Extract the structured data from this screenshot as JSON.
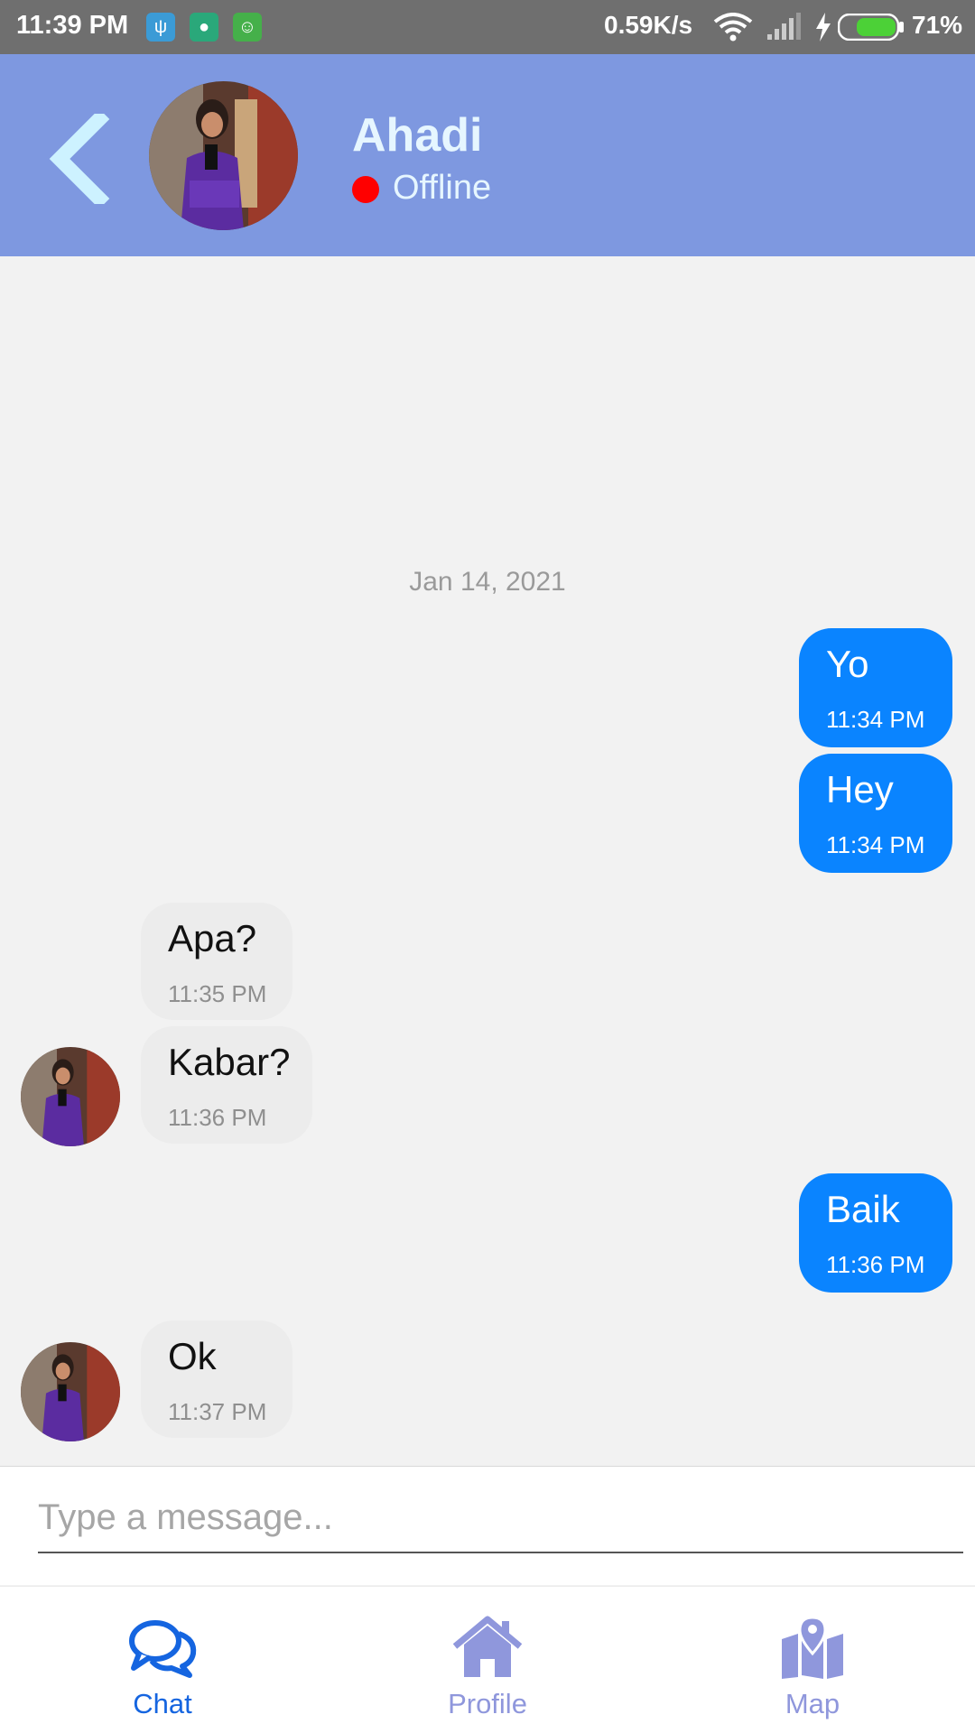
{
  "status_bar": {
    "time": "11:39 PM",
    "network_speed": "0.59K/s",
    "battery_percent": "71%",
    "battery_level": 0.71,
    "app_icons": [
      "usb-icon",
      "shield-icon",
      "android-icon"
    ]
  },
  "header": {
    "contact_name": "Ahadi",
    "status": "Offline",
    "status_color": "#ff0000",
    "background": "#7e98e0"
  },
  "conversation": {
    "date": "Jan 14, 2021",
    "messages": [
      {
        "direction": "sent",
        "text": "Yo",
        "time": "11:34 PM"
      },
      {
        "direction": "sent",
        "text": "Hey",
        "time": "11:34 PM"
      },
      {
        "direction": "received",
        "text": "Apa?",
        "time": "11:35 PM"
      },
      {
        "direction": "received",
        "text": "Kabar?",
        "time": "11:36 PM"
      },
      {
        "direction": "sent",
        "text": "Baik",
        "time": "11:36 PM"
      },
      {
        "direction": "received",
        "text": "Ok",
        "time": "11:37 PM"
      }
    ]
  },
  "composer": {
    "placeholder": "Type a message..."
  },
  "bottom_nav": {
    "items": [
      {
        "label": "Chat",
        "icon": "chat-bubbles-icon",
        "active": true
      },
      {
        "label": "Profile",
        "icon": "home-icon",
        "active": false
      },
      {
        "label": "Map",
        "icon": "map-pin-icon",
        "active": false
      }
    ],
    "active_color": "#1565e0",
    "inactive_color": "#8f97dc"
  }
}
